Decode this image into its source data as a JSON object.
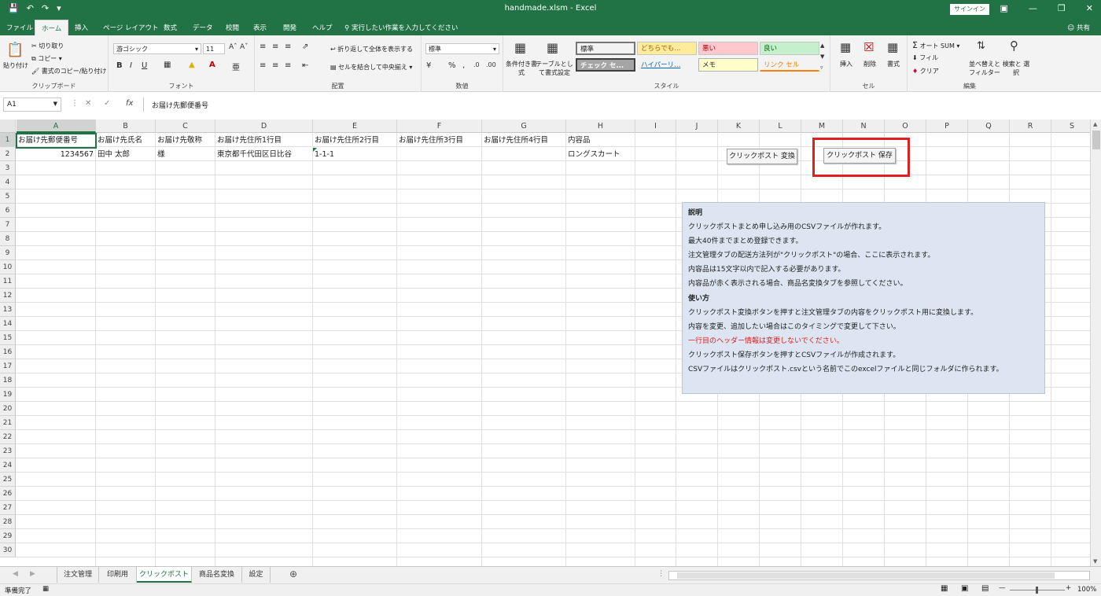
{
  "title_bar": {
    "title": "handmade.xlsm  -  Excel",
    "signin": "サインイン",
    "qat_icons": [
      "save-icon",
      "undo-icon",
      "redo-icon",
      "customize-icon"
    ]
  },
  "tabs": [
    {
      "label": "ファイル",
      "active": false
    },
    {
      "label": "ホーム",
      "active": true
    },
    {
      "label": "挿入",
      "active": false
    },
    {
      "label": "ページ レイアウト",
      "active": false
    },
    {
      "label": "数式",
      "active": false
    },
    {
      "label": "データ",
      "active": false
    },
    {
      "label": "校閲",
      "active": false
    },
    {
      "label": "表示",
      "active": false
    },
    {
      "label": "開発",
      "active": false
    },
    {
      "label": "ヘルプ",
      "active": false
    }
  ],
  "tell_me": "実行したい作業を入力してください",
  "share": "共有",
  "ribbon": {
    "clipboard": {
      "label": "クリップボード",
      "paste": "貼り付け",
      "cut": "切り取り",
      "copy": "コピー",
      "format_painter": "書式のコピー/貼り付け"
    },
    "font": {
      "label": "フォント",
      "font_name": "游ゴシック",
      "font_size": "11",
      "bold": "B",
      "italic": "I",
      "underline": "U"
    },
    "alignment": {
      "label": "配置",
      "wrap": "折り返して全体を表示する",
      "merge": "セルを結合して中央揃え"
    },
    "number": {
      "label": "数値",
      "format": "標準"
    },
    "styles": {
      "label": "スタイル",
      "cond_format": "条件付き書式",
      "table_format": "テーブルとして書式設定",
      "cells": [
        {
          "label": "標準",
          "bg": "#ffffff",
          "fg": "#000000"
        },
        {
          "label": "どちらでも...",
          "bg": "#ffeb9c",
          "fg": "#9c6500"
        },
        {
          "label": "悪い",
          "bg": "#ffc7ce",
          "fg": "#9c0006"
        },
        {
          "label": "良い",
          "bg": "#c6efce",
          "fg": "#006100"
        },
        {
          "label": "チェック セ...",
          "bg": "#a5a5a5",
          "fg": "#ffffff"
        },
        {
          "label": "ハイパーリ...",
          "bg": "#ffffff",
          "fg": "#0563c1"
        },
        {
          "label": "メモ",
          "bg": "#ffffcc",
          "fg": "#000000"
        },
        {
          "label": "リンク セル",
          "bg": "#ffffff",
          "fg": "#fa7d00"
        }
      ]
    },
    "cells_group": {
      "label": "セル",
      "insert": "挿入",
      "delete": "削除",
      "format": "書式"
    },
    "editing": {
      "label": "編集",
      "autosum": "オート SUM",
      "fill": "フィル",
      "clear": "クリア",
      "sort": "並べ替えと フィルター",
      "find": "検索と 選択"
    }
  },
  "formula_bar": {
    "name_box": "A1",
    "fx": "fx",
    "content": "お届け先郵便番号"
  },
  "columns": [
    "A",
    "B",
    "C",
    "D",
    "E",
    "F",
    "G",
    "H",
    "I",
    "J",
    "K",
    "L",
    "M",
    "N",
    "O",
    "P",
    "Q",
    "R",
    "S"
  ],
  "rows": [
    "1",
    "2",
    "3",
    "4",
    "5",
    "6",
    "7",
    "8",
    "9",
    "10",
    "11",
    "12",
    "13",
    "14",
    "15",
    "16",
    "17",
    "18",
    "19",
    "20",
    "21",
    "22",
    "23",
    "24",
    "25",
    "26",
    "27",
    "28",
    "29",
    "30"
  ],
  "header_row": [
    "お届け先郵便番号",
    "お届け先氏名",
    "お届け先敬称",
    "お届け先住所1行目",
    "お届け先住所2行目",
    "お届け先住所3行目",
    "お届け先住所4行目",
    "内容品"
  ],
  "data_row": [
    "1234567",
    "田中 太郎",
    "様",
    "東京都千代田区日比谷",
    "1-1-1",
    "",
    "",
    "ロングスカート"
  ],
  "buttons": {
    "convert": "クリックポスト 変換",
    "save": "クリックポスト 保存"
  },
  "info": {
    "heading1": "説明",
    "line1": "クリックポストまとめ申し込み用のCSVファイルが作れます。",
    "line2": "最大40件までまとめ登録できます。",
    "line3": "注文管理タブの配送方法列が\"クリックポスト\"の場合、ここに表示されます。",
    "line4": "内容品は15文字以内で記入する必要があります。",
    "line5": "内容品が赤く表示される場合、商品名変換タブを参照してください。",
    "heading2": "使い方",
    "line6": "クリックポスト変換ボタンを押すと注文管理タブの内容をクリックポスト用に変換します。",
    "line7": "内容を変更、追加したい場合はこのタイミングで変更して下さい。",
    "line8": "一行目のヘッダー情報は変更しないでください。",
    "line9": "クリックポスト保存ボタンを押すとCSVファイルが作成されます。",
    "line10": "CSVファイルはクリックポスト.csvという名前でこのexcelファイルと同じフォルダに作られます。",
    "warning_color": "#e02020"
  },
  "sheet_tabs": [
    {
      "label": "注文管理",
      "active": false
    },
    {
      "label": "印刷用",
      "active": false
    },
    {
      "label": "クリックポスト",
      "active": true
    },
    {
      "label": "商品名変換",
      "active": false
    },
    {
      "label": "設定",
      "active": false
    }
  ],
  "status": {
    "ready": "準備完了",
    "zoom": "100%"
  },
  "colors": {
    "excel_green": "#217346",
    "highlight_red": "#e02020",
    "info_bg": "#dce5f1"
  }
}
